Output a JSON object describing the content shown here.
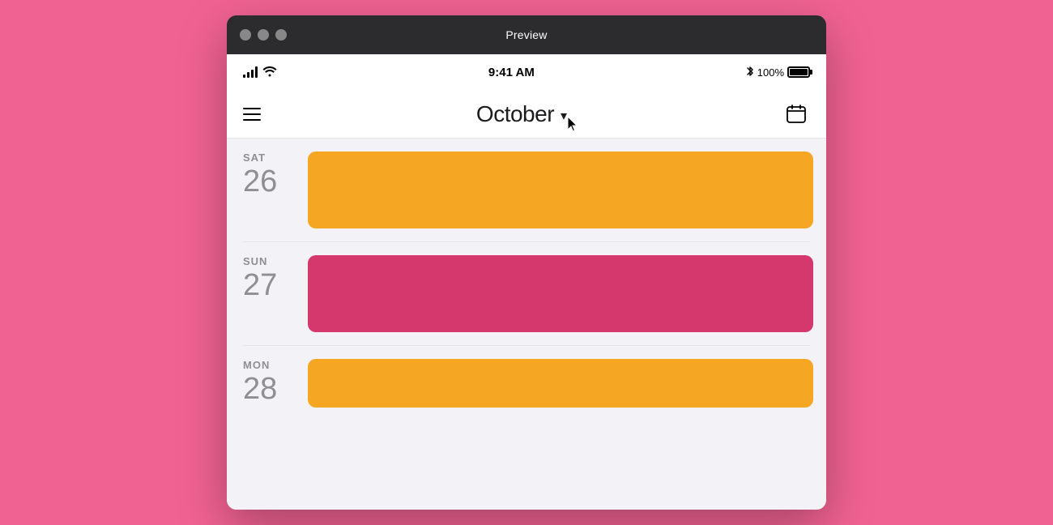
{
  "window": {
    "title": "Preview"
  },
  "statusBar": {
    "time": "9:41 AM",
    "batteryPercent": "100%"
  },
  "header": {
    "monthTitle": "October",
    "chevron": "▾"
  },
  "days": [
    {
      "name": "SAT",
      "number": "26",
      "eventColor": "orange"
    },
    {
      "name": "SUN",
      "number": "27",
      "eventColor": "pink"
    },
    {
      "name": "MON",
      "number": "28",
      "eventColor": "orange"
    }
  ]
}
